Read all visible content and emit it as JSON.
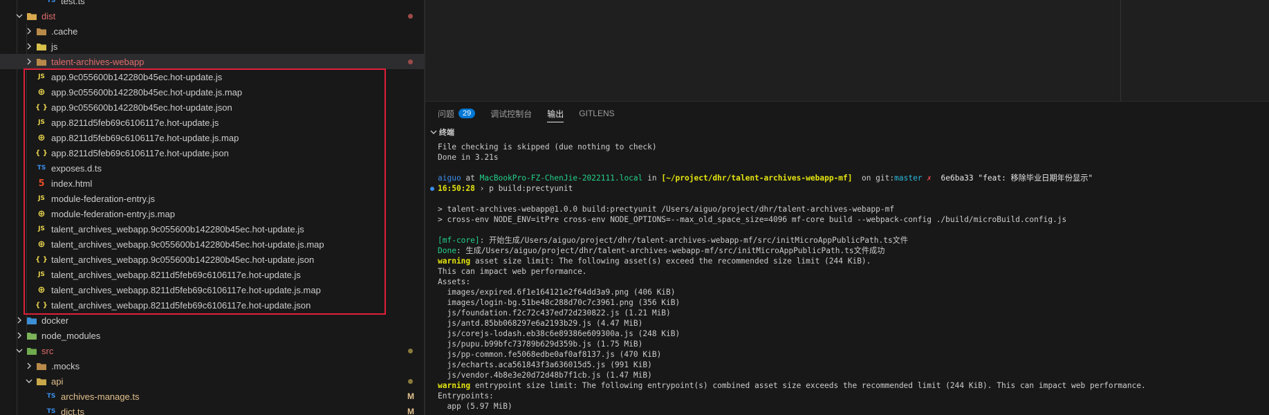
{
  "explorer": {
    "rows": [
      {
        "label": "test.ts",
        "icon": "ts",
        "indent": 3,
        "chevron": "none",
        "color": "normal"
      },
      {
        "label": "dist",
        "icon": "folder-dist",
        "indent": 1,
        "chevron": "down",
        "color": "git-red",
        "dot": "#9e4a4a"
      },
      {
        "label": ".cache",
        "icon": "folder",
        "indent": 2,
        "chevron": "right",
        "color": "normal"
      },
      {
        "label": "js",
        "icon": "folder-js",
        "indent": 2,
        "chevron": "right",
        "color": "normal"
      },
      {
        "label": "talent-archives-webapp",
        "icon": "folder",
        "indent": 2,
        "chevron": "right",
        "color": "git-red",
        "dot": "#9e4a4a",
        "selected": true
      },
      {
        "label": "app.9c055600b142280b45ec.hot-update.js",
        "icon": "js",
        "indent": 2,
        "chevron": "none",
        "color": "normal"
      },
      {
        "label": "app.9c055600b142280b45ec.hot-update.js.map",
        "icon": "map",
        "indent": 2,
        "chevron": "none",
        "color": "normal"
      },
      {
        "label": "app.9c055600b142280b45ec.hot-update.json",
        "icon": "json",
        "indent": 2,
        "chevron": "none",
        "color": "normal"
      },
      {
        "label": "app.8211d5feb69c6106117e.hot-update.js",
        "icon": "js",
        "indent": 2,
        "chevron": "none",
        "color": "normal"
      },
      {
        "label": "app.8211d5feb69c6106117e.hot-update.js.map",
        "icon": "map",
        "indent": 2,
        "chevron": "none",
        "color": "normal"
      },
      {
        "label": "app.8211d5feb69c6106117e.hot-update.json",
        "icon": "json",
        "indent": 2,
        "chevron": "none",
        "color": "normal"
      },
      {
        "label": "exposes.d.ts",
        "icon": "ts",
        "indent": 2,
        "chevron": "none",
        "color": "normal"
      },
      {
        "label": "index.html",
        "icon": "html",
        "indent": 2,
        "chevron": "none",
        "color": "normal"
      },
      {
        "label": "module-federation-entry.js",
        "icon": "js",
        "indent": 2,
        "chevron": "none",
        "color": "normal"
      },
      {
        "label": "module-federation-entry.js.map",
        "icon": "map",
        "indent": 2,
        "chevron": "none",
        "color": "normal"
      },
      {
        "label": "talent_archives_webapp.9c055600b142280b45ec.hot-update.js",
        "icon": "js",
        "indent": 2,
        "chevron": "none",
        "color": "normal"
      },
      {
        "label": "talent_archives_webapp.9c055600b142280b45ec.hot-update.js.map",
        "icon": "map",
        "indent": 2,
        "chevron": "none",
        "color": "normal"
      },
      {
        "label": "talent_archives_webapp.9c055600b142280b45ec.hot-update.json",
        "icon": "json",
        "indent": 2,
        "chevron": "none",
        "color": "normal"
      },
      {
        "label": "talent_archives_webapp.8211d5feb69c6106117e.hot-update.js",
        "icon": "js",
        "indent": 2,
        "chevron": "none",
        "color": "normal"
      },
      {
        "label": "talent_archives_webapp.8211d5feb69c6106117e.hot-update.js.map",
        "icon": "map",
        "indent": 2,
        "chevron": "none",
        "color": "normal"
      },
      {
        "label": "talent_archives_webapp.8211d5feb69c6106117e.hot-update.json",
        "icon": "json",
        "indent": 2,
        "chevron": "none",
        "color": "normal"
      },
      {
        "label": "docker",
        "icon": "folder-docker",
        "indent": 1,
        "chevron": "right",
        "color": "normal"
      },
      {
        "label": "node_modules",
        "icon": "folder-node",
        "indent": 1,
        "chevron": "right",
        "color": "normal"
      },
      {
        "label": "src",
        "icon": "folder-src",
        "indent": 1,
        "chevron": "down",
        "color": "git-red",
        "dot": "#8a7a3a"
      },
      {
        "label": ".mocks",
        "icon": "folder",
        "indent": 2,
        "chevron": "right",
        "color": "normal"
      },
      {
        "label": "api",
        "icon": "folder-api",
        "indent": 2,
        "chevron": "down",
        "color": "git-yellow",
        "dot": "#8a7a3a"
      },
      {
        "label": "archives-manage.ts",
        "icon": "ts",
        "indent": 3,
        "chevron": "none",
        "color": "git-yellow",
        "badge": "M"
      },
      {
        "label": "dict.ts",
        "icon": "ts",
        "indent": 3,
        "chevron": "none",
        "color": "git-yellow",
        "badge": "M"
      }
    ]
  },
  "panel": {
    "tabs": [
      {
        "label": "问题",
        "count": "29"
      },
      {
        "label": "调试控制台"
      },
      {
        "label": "输出",
        "active": true
      },
      {
        "label": "GITLENS"
      }
    ],
    "terminal_header": "终端"
  },
  "terminal": {
    "lines": [
      [
        {
          "t": "File checking is skipped (due nothing to check)"
        }
      ],
      [
        {
          "t": "Done in 3.21s"
        }
      ],
      [],
      [
        {
          "t": "aiguo",
          "c": "c-blue"
        },
        {
          "t": " at "
        },
        {
          "t": "MacBookPro-FZ-ChenJie-2022111.local",
          "c": "c-green"
        },
        {
          "t": " in "
        },
        {
          "t": "[~/project/dhr/talent-archives-webapp-mf]",
          "c": "c-yellow"
        },
        {
          "t": "  on git:"
        },
        {
          "t": "master",
          "c": "c-cyan"
        },
        {
          "t": " ✗",
          "c": "c-red"
        },
        {
          "t": "  6e6ba33 \"feat: 移除毕业日期年份显示\"",
          "c": "c-white"
        }
      ],
      [
        {
          "t": "16:50:28",
          "c": "c-yellow",
          "bullet": true
        },
        {
          "t": " › p build:prectyunit"
        }
      ],
      [],
      [
        {
          "t": "> talent-archives-webapp@1.0.0 build:prectyunit /Users/aiguo/project/dhr/talent-archives-webapp-mf"
        }
      ],
      [
        {
          "t": "> cross-env NODE_ENV=itPre cross-env NODE_OPTIONS=--max_old_space_size=4096 mf-core build --webpack-config ./build/microBuild.config.js"
        }
      ],
      [],
      [
        {
          "t": "[mf-core]",
          "c": "c-green"
        },
        {
          "t": ": 开始生成/Users/aiguo/project/dhr/talent-archives-webapp-mf/src/initMicroAppPublicPath.ts文件"
        }
      ],
      [
        {
          "t": "Done",
          "c": "c-green"
        },
        {
          "t": ": 生成/Users/aiguo/project/dhr/talent-archives-webapp-mf/src/initMicroAppPublicPath.ts文件成功"
        }
      ],
      [
        {
          "t": "warning",
          "c": "c-yellow"
        },
        {
          "t": " asset size limit: The following asset(s) exceed the recommended size limit (244 KiB)."
        }
      ],
      [
        {
          "t": "This can impact web performance."
        }
      ],
      [
        {
          "t": "Assets:"
        }
      ],
      [
        {
          "t": "  images/expired.6f1e164121e2f64dd3a9.png (406 KiB)"
        }
      ],
      [
        {
          "t": "  images/login-bg.51be48c288d70c7c3961.png (356 KiB)"
        }
      ],
      [
        {
          "t": "  js/foundation.f2c72c437ed72d230822.js (1.21 MiB)"
        }
      ],
      [
        {
          "t": "  js/antd.85bb068297e6a2193b29.js (4.47 MiB)"
        }
      ],
      [
        {
          "t": "  js/corejs-lodash.eb38c6e89386e609300a.js (248 KiB)"
        }
      ],
      [
        {
          "t": "  js/pupu.b99bfc73789b629d359b.js (1.75 MiB)"
        }
      ],
      [
        {
          "t": "  js/pp-common.fe5068edbe0af0af8137.js (470 KiB)"
        }
      ],
      [
        {
          "t": "  js/echarts.aca561843f3a636015d5.js (991 KiB)"
        }
      ],
      [
        {
          "t": "  js/vendor.4b8e3e20d72d48b7f1cb.js (1.47 MiB)"
        }
      ],
      [
        {
          "t": "warning",
          "c": "c-yellow"
        },
        {
          "t": " entrypoint size limit: The following entrypoint(s) combined asset size exceeds the recommended limit (244 KiB). This can impact web performance."
        }
      ],
      [
        {
          "t": "Entrypoints:"
        }
      ],
      [
        {
          "t": "  app (5.97 MiB)"
        }
      ]
    ]
  }
}
